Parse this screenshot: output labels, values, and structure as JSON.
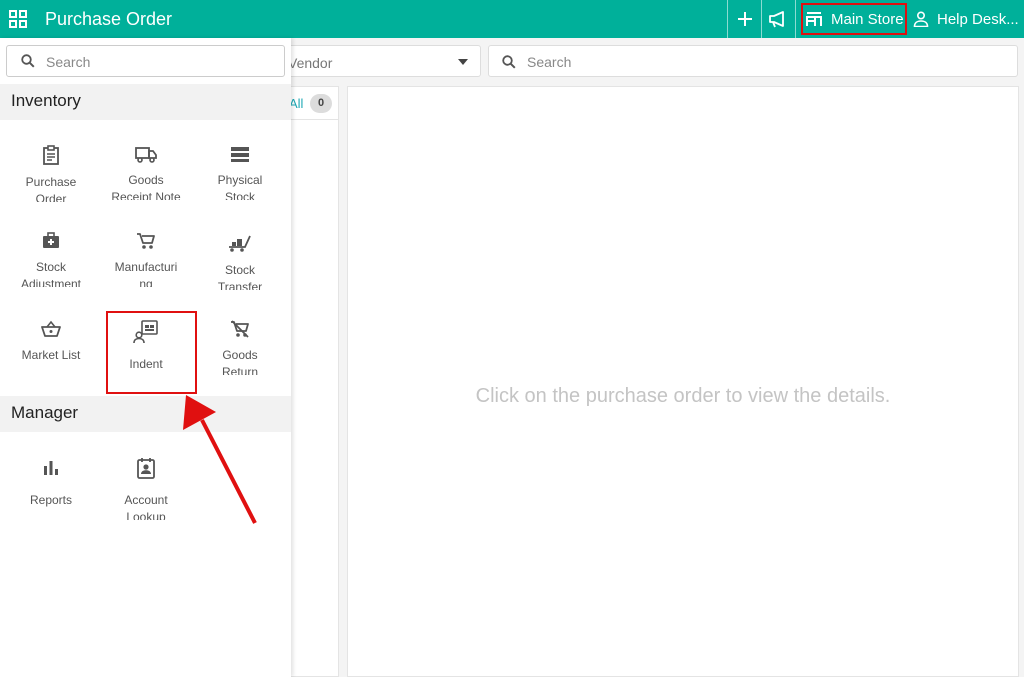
{
  "topbar": {
    "title": "Purchase Order",
    "store_label": "Main Store",
    "help_label": "Help Desk...",
    "icons": [
      "apps-grid-icon",
      "add-icon",
      "megaphone-icon",
      "store-icon",
      "user-icon"
    ]
  },
  "drawer": {
    "search_placeholder": "Search",
    "inventory": {
      "heading": "Inventory",
      "items": [
        {
          "line1": "Purchase",
          "line2": "Order",
          "icon": "clipboard-icon"
        },
        {
          "line1": "Goods",
          "line2": "Receipt Note",
          "icon": "truck-icon"
        },
        {
          "line1": "Physical",
          "line2": "Stock",
          "icon": "storage-icon"
        },
        {
          "line1": "Stock",
          "line2": "Adjustment",
          "icon": "medical-bag-icon"
        },
        {
          "line1": "Manufacturi",
          "line2": "ng",
          "icon": "cart-icon"
        },
        {
          "line1": "Stock",
          "line2": "Transfer",
          "icon": "trolley-icon"
        },
        {
          "line1": "Market List",
          "line2": "",
          "icon": "basket-icon"
        },
        {
          "line1": "Indent",
          "line2": "",
          "icon": "indent-icon"
        },
        {
          "line1": "Goods",
          "line2": "Return",
          "icon": "cart-off-icon"
        }
      ]
    },
    "manager": {
      "heading": "Manager",
      "items": [
        {
          "line1": "Reports",
          "line2": "",
          "icon": "bar-chart-icon"
        },
        {
          "line1": "Account",
          "line2": "Lookup",
          "icon": "contact-card-icon"
        }
      ]
    }
  },
  "filters": {
    "vendor_label": "Vendor",
    "search_placeholder": "Search"
  },
  "list": {
    "tab_all": "All",
    "count": "0"
  },
  "detail": {
    "empty_message": "Click on the purchase order to view the details."
  },
  "colors": {
    "brand": "#00b09a",
    "highlight": "#e01010",
    "link": "#1fa9b5"
  }
}
